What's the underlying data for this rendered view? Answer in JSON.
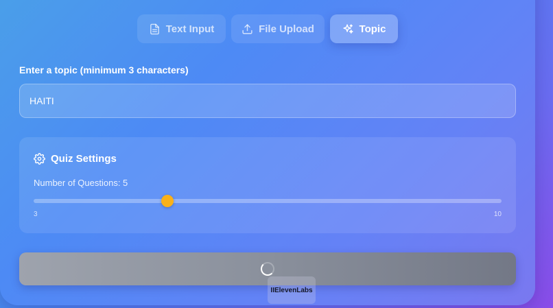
{
  "tabs": [
    {
      "label": "Text Input",
      "icon": "document-icon",
      "active": false
    },
    {
      "label": "File Upload",
      "icon": "upload-icon",
      "active": false
    },
    {
      "label": "Topic",
      "icon": "sparkles-icon",
      "active": true
    }
  ],
  "topic": {
    "label": "Enter a topic (minimum 3 characters)",
    "value": "HAITI"
  },
  "settings": {
    "title": "Quiz Settings",
    "icon": "gear-icon",
    "questions_label": "Number of Questions: 5",
    "questions": 5,
    "min": 3,
    "max": 10,
    "min_label": "3",
    "max_label": "10",
    "thumb_color": "#f9b11a"
  },
  "generate": {
    "state": "loading",
    "icon": "spinner-icon"
  },
  "badge": {
    "text": "IIElevenLabs"
  }
}
